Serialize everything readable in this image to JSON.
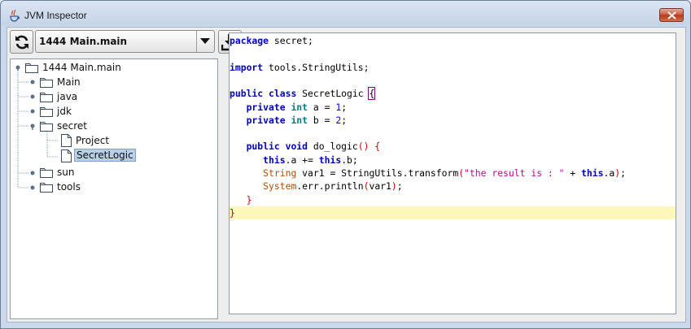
{
  "window": {
    "title": "JVM Inspector"
  },
  "toolbar": {
    "refresh_icon": "refresh-icon",
    "process_selected": "1444 Main.main",
    "dropdown_icon": "chevron-down-icon",
    "download_icon": "download-icon"
  },
  "tree": {
    "root": "1444 Main.main",
    "items": [
      {
        "label": "Main",
        "type": "folder"
      },
      {
        "label": "java",
        "type": "folder"
      },
      {
        "label": "jdk",
        "type": "folder"
      },
      {
        "label": "secret",
        "type": "folder",
        "expanded": true
      },
      {
        "label": "Project",
        "type": "file",
        "parent": "secret"
      },
      {
        "label": "SecretLogic",
        "type": "file",
        "parent": "secret",
        "selected": true
      },
      {
        "label": "sun",
        "type": "folder"
      },
      {
        "label": "tools",
        "type": "folder"
      }
    ]
  },
  "editor": {
    "lines": [
      "package secret;",
      "",
      "import tools.StringUtils;",
      "",
      "public class SecretLogic {",
      "   private int a = 1;",
      "   private int b = 2;",
      "",
      "   public void do_logic() {",
      "      this.a += this.b;",
      "      String var1 = StringUtils.transform(\"the result is : \" + this.a);",
      "      System.err.println(var1);",
      "   }",
      "}"
    ],
    "highlighted_line": 14
  }
}
